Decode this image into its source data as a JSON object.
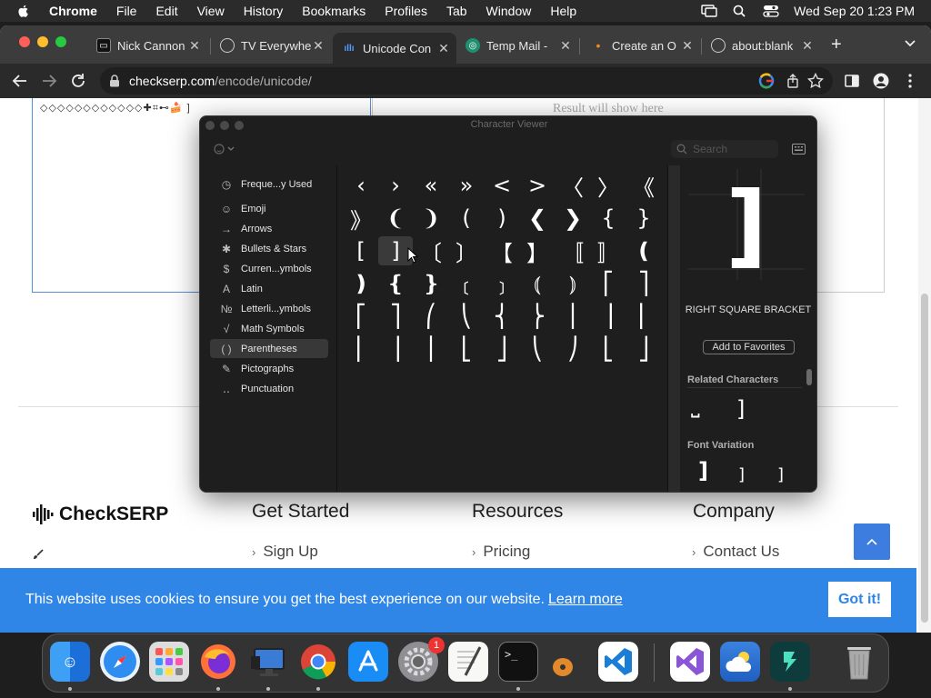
{
  "menubar": {
    "app": "Chrome",
    "items": [
      "File",
      "Edit",
      "View",
      "History",
      "Bookmarks",
      "Profiles",
      "Tab",
      "Window",
      "Help"
    ],
    "clock": "Wed Sep 20  1:23 PM"
  },
  "tabs": [
    {
      "title": "Nick Cannon",
      "favicon": "tv-icon"
    },
    {
      "title": "TV Everywhe",
      "favicon": "globe-icon"
    },
    {
      "title": "Unicode Con",
      "favicon": "checkserp-icon",
      "active": true
    },
    {
      "title": "Temp Mail -",
      "favicon": "tempmail-icon"
    },
    {
      "title": "Create an O",
      "favicon": "dot-icon"
    },
    {
      "title": "about:blank",
      "favicon": "globe-icon"
    }
  ],
  "address": {
    "domain": "checkserp.com",
    "path": "/encode/unicode/"
  },
  "page": {
    "input_text": "◇◇◇◇◇◇◇◇◇◇◇◇✚⌗⊷🍰 ]",
    "result_placeholder": "Result will show here",
    "brand": "CheckSERP",
    "columns": [
      {
        "heading": "Get Started",
        "link": "Sign Up"
      },
      {
        "heading": "Resources",
        "link": "Pricing"
      },
      {
        "heading": "Company",
        "link": "Contact Us"
      }
    ],
    "cookie_message": "This website uses cookies to ensure you get the best experience on our website.",
    "cookie_learn": "Learn more",
    "cookie_accept": "Got it!"
  },
  "viewer": {
    "title": "Character Viewer",
    "search_placeholder": "Search",
    "categories": [
      {
        "label": "Freque...y Used",
        "icon": "clock-icon",
        "glyph": "◷"
      },
      {
        "label": "Emoji",
        "icon": "smiley-icon",
        "glyph": "☺"
      },
      {
        "label": "Arrows",
        "icon": "arrow-icon",
        "glyph": "→"
      },
      {
        "label": "Bullets & Stars",
        "icon": "asterisk-icon",
        "glyph": "✱"
      },
      {
        "label": "Curren...ymbols",
        "icon": "dollar-icon",
        "glyph": "$"
      },
      {
        "label": "Latin",
        "icon": "latin-a-icon",
        "glyph": "A"
      },
      {
        "label": "Letterli...ymbols",
        "icon": "numero-icon",
        "glyph": "№"
      },
      {
        "label": "Math Symbols",
        "icon": "sqrt-icon",
        "glyph": "√"
      },
      {
        "label": "Parentheses",
        "icon": "parentheses-icon",
        "glyph": "( )",
        "selected": true
      },
      {
        "label": "Pictographs",
        "icon": "pictograph-icon",
        "glyph": "✎"
      },
      {
        "label": "Punctuation",
        "icon": "punctuation-icon",
        "glyph": "‥"
      }
    ],
    "chars": [
      [
        "‹",
        "›",
        "«",
        "»",
        "<",
        ">",
        "〈",
        "〉",
        "《"
      ],
      [
        "》",
        "❨",
        "❩",
        "(",
        ")",
        "❮",
        "❯",
        "{",
        "}"
      ],
      [
        "[",
        "]",
        "〔",
        "〕",
        "【",
        "】",
        "〚",
        "〛",
        "❪"
      ],
      [
        "❫",
        "❴",
        "❵",
        "﹝",
        "﹞",
        "⦅",
        "⦆",
        "⎡",
        "⎤"
      ],
      [
        "⎡",
        "⎤",
        "⎛",
        "⎝",
        "⎨",
        "⎬",
        "⎪",
        "⎥",
        "⎢"
      ],
      [
        "⎢",
        "⎥",
        "⎪",
        "⎣",
        "⎦",
        "⎝",
        "⎠",
        "⎣",
        "⎦"
      ]
    ],
    "selected_char": "]",
    "selected_name": "RIGHT SQUARE BRACKET",
    "add_favorites": "Add to Favorites",
    "related_heading": "Related Characters",
    "related": [
      "⎵",
      "]"
    ],
    "variation_heading": "Font Variation",
    "variations": [
      "]",
      "]",
      "]"
    ]
  },
  "dock": {
    "settings_badge": "1"
  }
}
